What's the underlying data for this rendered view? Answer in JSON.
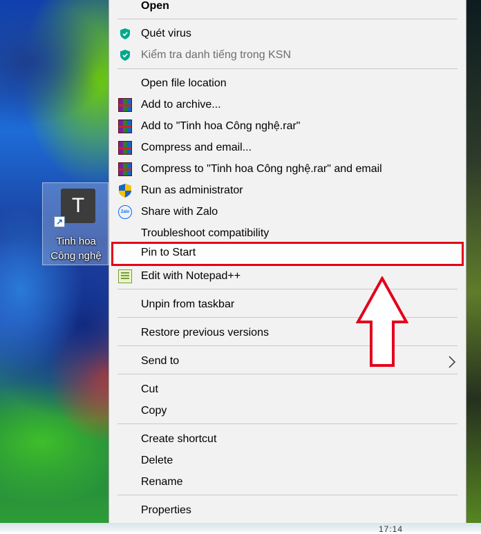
{
  "desktop": {
    "shortcut": {
      "tile_letter": "T",
      "label_line1": "Tinh hoa",
      "label_line2": "Công nghệ"
    },
    "clock_fragment": "17:14"
  },
  "context_menu": {
    "open": "Open",
    "scan_virus": "Quét virus",
    "check_reputation": "Kiểm tra danh tiếng trong KSN",
    "open_file_location": "Open file location",
    "add_to_archive": "Add to archive...",
    "add_to_rar": "Add to \"Tinh hoa Công nghệ.rar\"",
    "compress_and_email": "Compress and email...",
    "compress_to_rar_and_email": "Compress to \"Tinh hoa Công nghệ.rar\" and email",
    "run_as_admin": "Run as administrator",
    "share_with_zalo": "Share with Zalo",
    "troubleshoot_compatibility": "Troubleshoot compatibility",
    "pin_to_start": "Pin to Start",
    "edit_with_notepad": "Edit with Notepad++",
    "unpin_from_taskbar": "Unpin from taskbar",
    "restore_previous_versions": "Restore previous versions",
    "send_to": "Send to",
    "cut": "Cut",
    "copy": "Copy",
    "create_shortcut": "Create shortcut",
    "delete": "Delete",
    "rename": "Rename",
    "properties": "Properties",
    "zalo_icon_text": "Zalo"
  },
  "icons": {
    "kaspersky": "shield-icon",
    "winrar": "winrar-icon",
    "uac": "uac-shield-icon",
    "zalo": "zalo-icon",
    "notepad": "notepad-plus-plus-icon",
    "submenu": "chevron-right-icon"
  },
  "colors": {
    "highlight": "#e3001b",
    "menu_background": "#f2f2f2",
    "kaspersky_green": "#00a88e",
    "zalo_blue": "#0068ff"
  }
}
